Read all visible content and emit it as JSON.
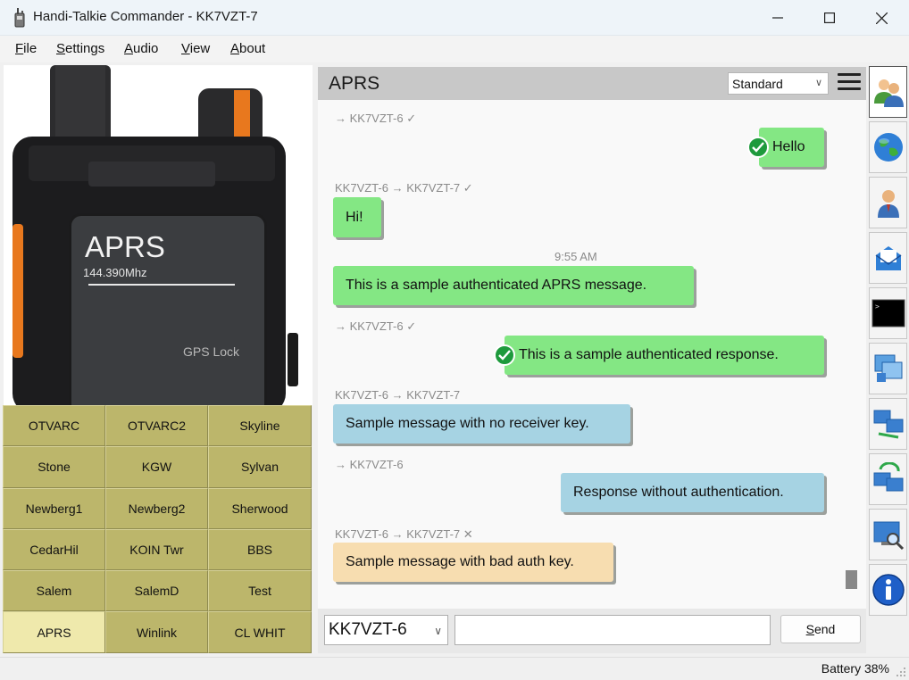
{
  "window": {
    "title": "Handi-Talkie Commander - KK7VZT-7",
    "minimize_icon": "minimize-icon",
    "maximize_icon": "maximize-icon",
    "close_icon": "close-icon"
  },
  "menu": [
    {
      "label": "File",
      "mnemonic": "F",
      "rest": "ile"
    },
    {
      "label": "Settings",
      "mnemonic": "S",
      "rest": "ettings"
    },
    {
      "label": "Audio",
      "mnemonic": "A",
      "rest": "udio"
    },
    {
      "label": "View",
      "mnemonic": "V",
      "rest": "iew"
    },
    {
      "label": "About",
      "mnemonic": "A",
      "rest": "bout"
    }
  ],
  "radio": {
    "screen_title": "APRS",
    "frequency": "144.390Mhz",
    "gps_status": "GPS Lock"
  },
  "channels": [
    {
      "label": "OTVARC",
      "active": false
    },
    {
      "label": "OTVARC2",
      "active": false
    },
    {
      "label": "Skyline",
      "active": false
    },
    {
      "label": "Stone",
      "active": false
    },
    {
      "label": "KGW",
      "active": false
    },
    {
      "label": "Sylvan",
      "active": false
    },
    {
      "label": "Newberg1",
      "active": false
    },
    {
      "label": "Newberg2",
      "active": false
    },
    {
      "label": "Sherwood",
      "active": false
    },
    {
      "label": "CedarHil",
      "active": false
    },
    {
      "label": "KOIN Twr",
      "active": false
    },
    {
      "label": "BBS",
      "active": false
    },
    {
      "label": "Salem",
      "active": false
    },
    {
      "label": "SalemD",
      "active": false
    },
    {
      "label": "Test",
      "active": false
    },
    {
      "label": "APRS",
      "active": true
    },
    {
      "label": "Winlink",
      "active": false
    },
    {
      "label": "CL WHIT",
      "active": false
    }
  ],
  "chat": {
    "title": "APRS",
    "mode": "Standard",
    "menu_icon": "hamburger-menu-icon",
    "messages": [
      {
        "meta": "→ KK7VZT-6 ✓",
        "text": "Hello",
        "direction": "outgoing",
        "color": "#84e784",
        "verified": true
      },
      {
        "meta": "KK7VZT-6 → KK7VZT-7 ✓",
        "text": "Hi!",
        "direction": "incoming",
        "color": "#84e784",
        "verified": false
      },
      {
        "timestamp": "9:55 AM"
      },
      {
        "text": "This is a sample authenticated APRS message.",
        "direction": "incoming",
        "color": "#84e784",
        "verified": false
      },
      {
        "meta": "→ KK7VZT-6 ✓",
        "text": "This is a sample authenticated response.",
        "direction": "outgoing",
        "color": "#84e784",
        "verified": true
      },
      {
        "meta": "KK7VZT-6 → KK7VZT-7",
        "text": "Sample message with no receiver key.",
        "direction": "incoming",
        "color": "#a6d3e3",
        "verified": false
      },
      {
        "meta": "→ KK7VZT-6",
        "text": "Response without authentication.",
        "direction": "outgoing",
        "color": "#a6d3e3",
        "verified": false
      },
      {
        "meta": "KK7VZT-6 → KK7VZT-7 ✕",
        "text": "Sample message with bad auth key.",
        "direction": "incoming",
        "color": "#f7ddb0",
        "verified": false
      }
    ]
  },
  "compose": {
    "destination": "KK7VZT-6",
    "message_value": "",
    "send_label": "Send",
    "send_mnemonic": "S",
    "send_rest": "end"
  },
  "sidebar": [
    "contacts-icon",
    "globe-icon",
    "user-icon",
    "mail-icon",
    "terminal-icon",
    "windows-icon",
    "network-icon",
    "network-sync-icon",
    "monitor-search-icon",
    "info-icon"
  ],
  "status": {
    "battery": "Battery 38%"
  },
  "colors": {
    "channel_bg": "#bcb66b",
    "channel_active_bg": "#efe9ac",
    "bubble_green": "#84e784",
    "bubble_blue": "#a6d3e3",
    "bubble_orange": "#f7ddb0",
    "verified_check": "#1e9a3c"
  }
}
